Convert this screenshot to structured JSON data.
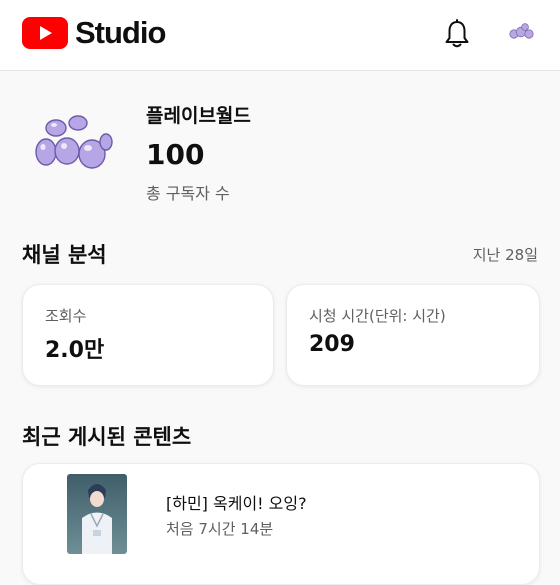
{
  "app": {
    "logo_text": "Studio",
    "brand_color": "#ff0000"
  },
  "header": {
    "icons": [
      "youtube-logo-icon",
      "bell-icon",
      "profile-avatar-icon"
    ]
  },
  "channel": {
    "name": "플레이브월드",
    "subscriber_count": "100",
    "subscriber_label": "총 구독자 수"
  },
  "analytics": {
    "title": "채널 분석",
    "range": "지난 28일",
    "cards": [
      {
        "label": "조회수",
        "value": "2.0만"
      },
      {
        "label": "시청 시간(단위: 시간)",
        "value": "209"
      }
    ]
  },
  "recent": {
    "title": "최근 게시된 콘텐츠",
    "items": [
      {
        "title": "[하민] 옥케이! 오잉?",
        "meta": "처음 7시간 14분"
      }
    ]
  }
}
